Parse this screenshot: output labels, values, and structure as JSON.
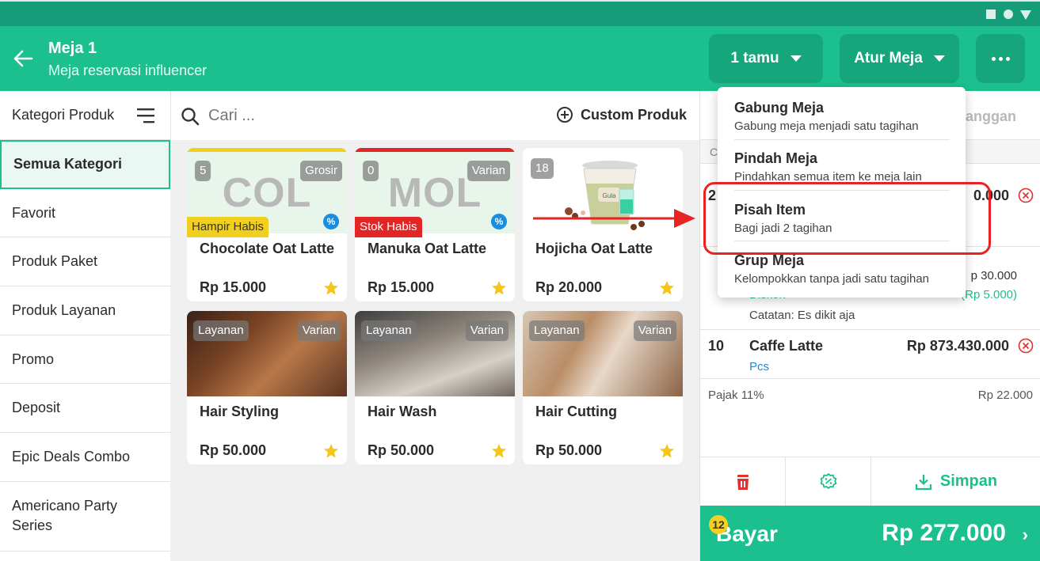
{
  "header": {
    "title": "Meja 1",
    "subtitle": "Meja reservasi influencer",
    "guests_label": "1 tamu",
    "table_settings_label": "Atur Meja"
  },
  "sidebar": {
    "heading": "Kategori Produk",
    "items": [
      {
        "label": "Semua Kategori"
      },
      {
        "label": "Favorit"
      },
      {
        "label": "Produk Paket"
      },
      {
        "label": "Produk Layanan"
      },
      {
        "label": "Promo"
      },
      {
        "label": "Deposit"
      },
      {
        "label": "Epic Deals Combo"
      },
      {
        "label": "Americano Party Series"
      }
    ]
  },
  "search": {
    "placeholder": "Cari ...",
    "custom_product_label": "Custom Produk"
  },
  "products": [
    {
      "name": "Chocolate Oat Latte",
      "price": "Rp 15.000",
      "initials": "COL",
      "stock": "5",
      "badge": "Grosir",
      "status": "Hampir Habis"
    },
    {
      "name": "Manuka Oat Latte",
      "price": "Rp 15.000",
      "initials": "MOL",
      "stock": "0",
      "badge": "Varian",
      "status": "Stok Habis"
    },
    {
      "name": "Hojicha Oat Latte",
      "price": "Rp 20.000",
      "stock": "18",
      "cup_text": "Gula"
    },
    {
      "name": "Hair Styling",
      "price": "Rp 50.000",
      "tag": "Layanan",
      "badge": "Varian"
    },
    {
      "name": "Hair Wash",
      "price": "Rp 50.000",
      "tag": "Layanan",
      "badge": "Varian"
    },
    {
      "name": "Hair Cutting",
      "price": "Rp 50.000",
      "tag": "Layanan",
      "badge": "Varian"
    }
  ],
  "cart": {
    "tab_peek": "anggan",
    "sub_peek": "Ca",
    "rows": [
      {
        "qty": "2",
        "amount_peek": "0.000"
      },
      {
        "amount_peek": "p 30.000",
        "discount_label": "Diskon",
        "discount_peek": "(Rp 5.000)",
        "note": "Catatan: Es dikit aja"
      },
      {
        "qty": "10",
        "name": "Caffe Latte",
        "amount": "Rp 873.430.000",
        "unit": "Pcs"
      }
    ],
    "tax_label": "Pajak 11%",
    "tax_value": "Rp 22.000",
    "save_label": "Simpan",
    "pay_label": "Bayar",
    "pay_total": "Rp 277.000",
    "item_count": "12"
  },
  "menu": {
    "items": [
      {
        "title": "Gabung Meja",
        "desc": "Gabung meja menjadi satu tagihan"
      },
      {
        "title": "Pindah Meja",
        "desc": "Pindahkan semua item ke meja lain"
      },
      {
        "title": "Pisah Item",
        "desc": "Bagi jadi 2 tagihan"
      },
      {
        "title": "Grup Meja",
        "desc": "Kelompokkan tanpa jadi satu tagihan"
      }
    ]
  },
  "colors": {
    "primary": "#1cc08f",
    "primary_dark": "#15a67b",
    "danger": "#e82323",
    "star": "#f5c518",
    "info": "#1a8de0"
  }
}
